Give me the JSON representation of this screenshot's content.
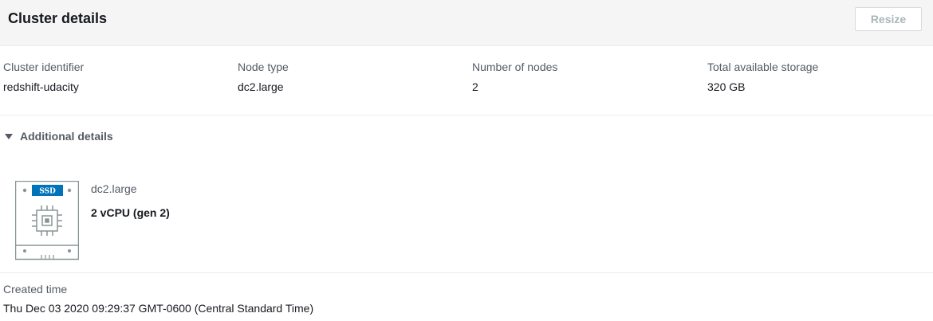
{
  "header": {
    "title": "Cluster details",
    "resize_label": "Resize"
  },
  "summary": {
    "cluster_identifier": {
      "label": "Cluster identifier",
      "value": "redshift-udacity"
    },
    "node_type": {
      "label": "Node type",
      "value": "dc2.large"
    },
    "number_of_nodes": {
      "label": "Number of nodes",
      "value": "2"
    },
    "total_storage": {
      "label": "Total available storage",
      "value": "320 GB"
    }
  },
  "additional": {
    "toggle_label": "Additional details",
    "expanded": true,
    "node_card": {
      "badge": "SSD",
      "icon": "ssd-chip-icon",
      "node_type": "dc2.large",
      "spec": "2 vCPU (gen 2)"
    }
  },
  "created": {
    "label": "Created time",
    "value": "Thu Dec 03 2020 09:29:37 GMT-0600 (Central Standard Time)"
  },
  "colors": {
    "header_bg": "#f5f5f5",
    "ssd_badge": "#0073bb",
    "icon_gray": "#879596",
    "label_gray": "#545b64"
  }
}
